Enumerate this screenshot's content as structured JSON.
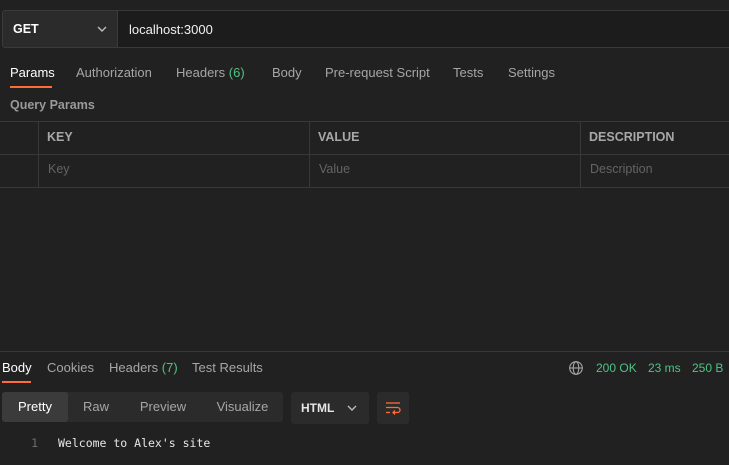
{
  "request": {
    "method": "GET",
    "url": "localhost:3000"
  },
  "request_tabs": [
    {
      "label": "Params"
    },
    {
      "label": "Authorization"
    },
    {
      "label": "Headers",
      "count": "(6)"
    },
    {
      "label": "Body"
    },
    {
      "label": "Pre-request Script"
    },
    {
      "label": "Tests"
    },
    {
      "label": "Settings"
    }
  ],
  "params": {
    "section_label": "Query Params",
    "columns": [
      "KEY",
      "VALUE",
      "DESCRIPTION"
    ],
    "placeholders": [
      "Key",
      "Value",
      "Description"
    ]
  },
  "response_tabs": [
    {
      "label": "Body"
    },
    {
      "label": "Cookies"
    },
    {
      "label": "Headers",
      "count": "(7)"
    },
    {
      "label": "Test Results"
    }
  ],
  "response_status": {
    "status": "200 OK",
    "time": "23 ms",
    "size": "250 B"
  },
  "view_modes": [
    "Pretty",
    "Raw",
    "Preview",
    "Visualize"
  ],
  "format": "HTML",
  "body_lines": [
    {
      "number": "1",
      "text": "Welcome to Alex's site"
    }
  ],
  "colors": {
    "accent": "#ff6c37",
    "success": "#4fc383",
    "background": "#212121"
  },
  "icons": [
    "chevron-down-icon",
    "globe-icon",
    "wrap-lines-icon"
  ]
}
